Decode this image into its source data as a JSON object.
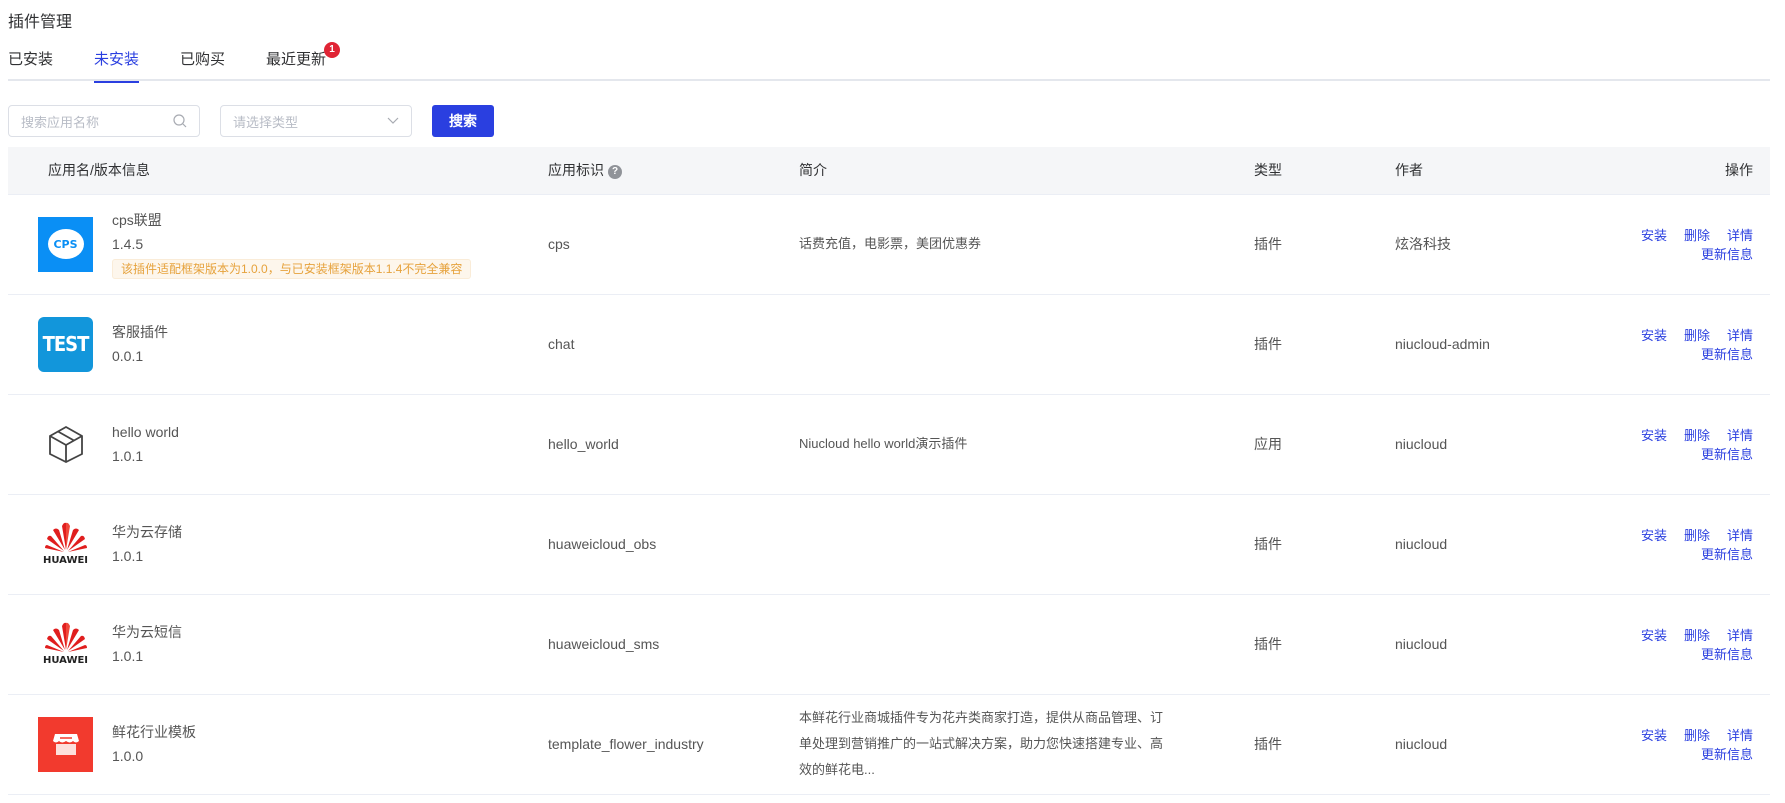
{
  "page_title": "插件管理",
  "tabs": [
    {
      "label": "已安装"
    },
    {
      "label": "未安装",
      "active": true
    },
    {
      "label": "已购买"
    },
    {
      "label": "最近更新",
      "badge": "1"
    }
  ],
  "filters": {
    "search_placeholder": "搜索应用名称",
    "type_placeholder": "请选择类型",
    "search_button": "搜索"
  },
  "table": {
    "headers": {
      "name": "应用名/版本信息",
      "key": "应用标识",
      "desc": "简介",
      "type": "类型",
      "author": "作者",
      "actions": "操作"
    },
    "action_labels": {
      "install": "安装",
      "delete": "删除",
      "detail": "详情",
      "update_info": "更新信息"
    },
    "rows": [
      {
        "name": "cps联盟",
        "version": "1.4.5",
        "warning": "该插件适配框架版本为1.0.0，与已安装框架版本1.1.4不完全兼容",
        "key": "cps",
        "desc": "话费充值，电影票，美团优惠券",
        "type": "插件",
        "author": "炫洛科技",
        "icon": "cps-logo",
        "icon_text": "CPS"
      },
      {
        "name": "客服插件",
        "version": "0.0.1",
        "key": "chat",
        "desc": "",
        "type": "插件",
        "author": "niucloud-admin",
        "icon": "test-logo",
        "icon_text": "TEST"
      },
      {
        "name": "hello world",
        "version": "1.0.1",
        "key": "hello_world",
        "desc": "Niucloud hello world演示插件",
        "type": "应用",
        "author": "niucloud",
        "icon": "cube-icon"
      },
      {
        "name": "华为云存储",
        "version": "1.0.1",
        "key": "huaweicloud_obs",
        "desc": "",
        "type": "插件",
        "author": "niucloud",
        "icon": "huawei-logo",
        "icon_text": "HUAWEI"
      },
      {
        "name": "华为云短信",
        "version": "1.0.1",
        "key": "huaweicloud_sms",
        "desc": "",
        "type": "插件",
        "author": "niucloud",
        "icon": "huawei-logo",
        "icon_text": "HUAWEI"
      },
      {
        "name": "鲜花行业模板",
        "version": "1.0.0",
        "key": "template_flower_industry",
        "desc": "本鲜花行业商城插件专为花卉类商家打造，提供从商品管理、订单处理到营销推广的一站式解决方案，助力您快速搭建专业、高效的鲜花电...",
        "type": "插件",
        "author": "niucloud",
        "icon": "store-icon"
      }
    ]
  }
}
